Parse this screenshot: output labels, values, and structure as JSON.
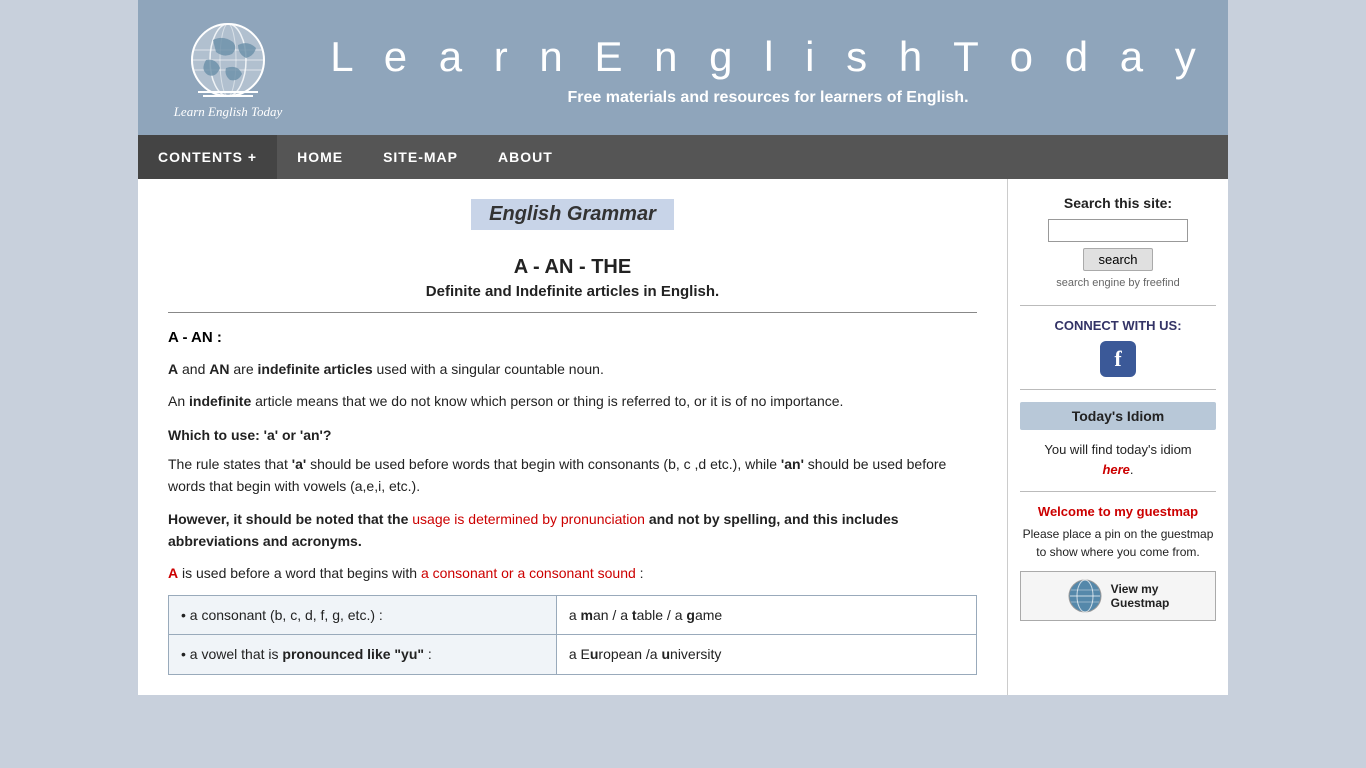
{
  "header": {
    "site_title": "L e a r n   E n g l i s h   T o d a y",
    "tagline": "Free materials and resources for learners of English.",
    "logo_text": "Learn English Today"
  },
  "navbar": {
    "items": [
      {
        "label": "CONTENTS +",
        "id": "contents"
      },
      {
        "label": "HOME",
        "id": "home"
      },
      {
        "label": "SITE-MAP",
        "id": "sitemap"
      },
      {
        "label": "ABOUT",
        "id": "about"
      }
    ]
  },
  "content": {
    "page_heading": "English Grammar",
    "article_title": "A - AN - THE",
    "article_subtitle": "Definite and Indefinite articles in English.",
    "section_label": "A - AN   :",
    "para1": "A and AN are indefinite articles used with a singular countable noun.",
    "para1_bold_A": "A",
    "para1_bold_AN": "AN",
    "para1_bold_indefinite_articles": "indefinite articles",
    "para2_prefix": "An ",
    "para2_bold": "indefinite",
    "para2_suffix": " article means that we do not know which person or thing is referred to, or it is of no importance.",
    "which_use_heading": "Which to use:  'a' or 'an'?",
    "rule_para": "The rule states that ",
    "rule_a": "'a'",
    "rule_mid": " should be used before words that begin with consonants (b, c ,d etc.), while ",
    "rule_an": "'an'",
    "rule_end": " should be used before words that begin with vowels (a,e,i, etc.).",
    "however_bold": "However, it should be noted that the ",
    "however_red": "usage is determined by pronunciation",
    "however_end": " and not by spelling, and this includes abbreviations and acronyms.",
    "a_used": "A",
    "a_used_suffix": " is used before a word that begins with ",
    "a_used_red": "a consonant or a consonant sound",
    "a_used_end": " :",
    "table_rows": [
      {
        "left": "• a consonant (b, c, d, f, g, etc.) :",
        "right_prefix": "a ",
        "right_bold": "m",
        "right_suffix": "an / a ",
        "right_bold2": "t",
        "right_suffix2": "able / a ",
        "right_bold3": "g",
        "right_suffix3": "ame"
      },
      {
        "left_prefix": "• a vowel that is ",
        "left_bold": "pronounced like \"yu\"",
        "left_suffix": " :",
        "right_prefix": "a E",
        "right_bold": "u",
        "right_suffix": "ropean /a ",
        "right_bold2": "u",
        "right_suffix2": "niversity"
      }
    ]
  },
  "sidebar": {
    "search_title": "Search this site:",
    "search_placeholder": "",
    "search_button": "search",
    "search_engine_text": "search engine by freefind",
    "connect_title": "CONNECT WITH US:",
    "todays_idiom_label": "Today's Idiom",
    "idiom_text": "You will find today's idiom",
    "idiom_here": "here",
    "guestmap_welcome": "Welcome to my guestmap",
    "guestmap_text": "Please place a pin on the guestmap to show where you come from.",
    "guestmap_button": "View my\nGuestmap"
  }
}
